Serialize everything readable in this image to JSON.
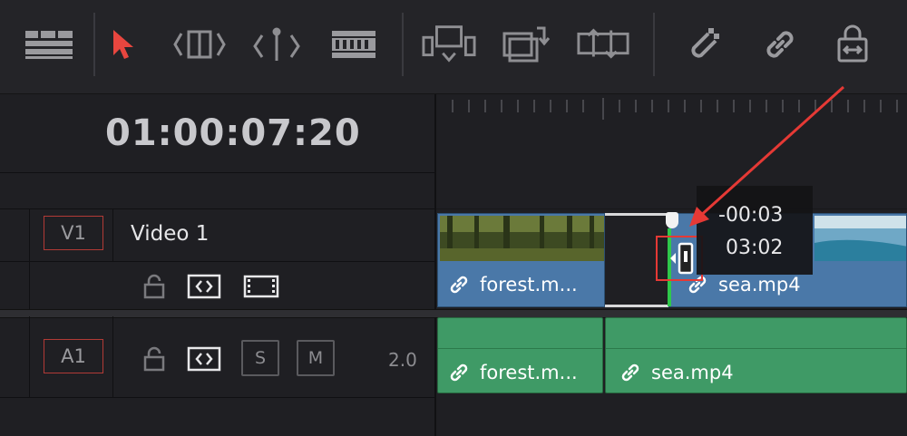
{
  "toolbar": {
    "icons": [
      "timeline-view-options-icon",
      "selection-mode-icon",
      "trim-edit-mode-icon",
      "dynamic-trim-mode-icon",
      "blade-edit-mode-icon",
      "insert-clip-icon",
      "overwrite-clip-icon",
      "replace-clip-icon",
      "snapping-icon",
      "linked-selection-icon",
      "position-lock-icon"
    ],
    "active_color": "#e8463f"
  },
  "timecode": "01:00:07:20",
  "tracks": {
    "video": {
      "badge": "V1",
      "name": "Video 1"
    },
    "audio": {
      "badge": "A1",
      "solo_label": "S",
      "mute_label": "M",
      "channels": "2.0"
    }
  },
  "clips": {
    "video": [
      {
        "name": "forest.m...",
        "color": "#4a78a8"
      },
      {
        "name": "sea.mp4",
        "color": "#4a78a8"
      }
    ],
    "audio": [
      {
        "name": "forest.m...",
        "color": "#3f9a66"
      },
      {
        "name": "sea.mp4",
        "color": "#3f9a66"
      }
    ]
  },
  "tooltip": {
    "offset": "-00:03",
    "duration": "03:02"
  },
  "annotation_color": "#e53935"
}
